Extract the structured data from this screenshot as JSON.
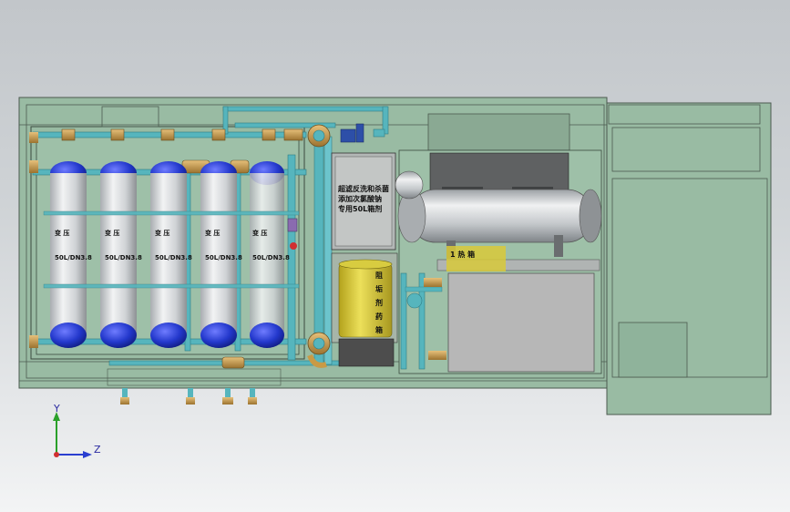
{
  "vessels": [
    {
      "type_label": "变 压",
      "spec": "50L/DN3.8"
    },
    {
      "type_label": "变 压",
      "spec": "50L/DN3.8"
    },
    {
      "type_label": "变 压",
      "spec": "50L/DN3.8"
    },
    {
      "type_label": "变 压",
      "spec": "50L/DN3.8"
    },
    {
      "type_label": "变 压",
      "spec": "50L/DN3.8"
    }
  ],
  "control_box_lines": [
    "超滤反洗和杀菌",
    "添加次氯酸钠",
    "专用50L箱剂"
  ],
  "dosing_tank_text": [
    "阻",
    "垢",
    "剂",
    "药",
    "箱"
  ],
  "small_tag": "1 热 箱",
  "axes": {
    "y": "Y",
    "z": "Z"
  },
  "colors": {
    "frame": "#8fb49a",
    "pipe": "#56b5bd",
    "vessel_cap": "#2a3fd0",
    "flange": "#c99a45",
    "dosing_tank": "#d8c93a",
    "chest_tank": "#bfc4c8"
  }
}
